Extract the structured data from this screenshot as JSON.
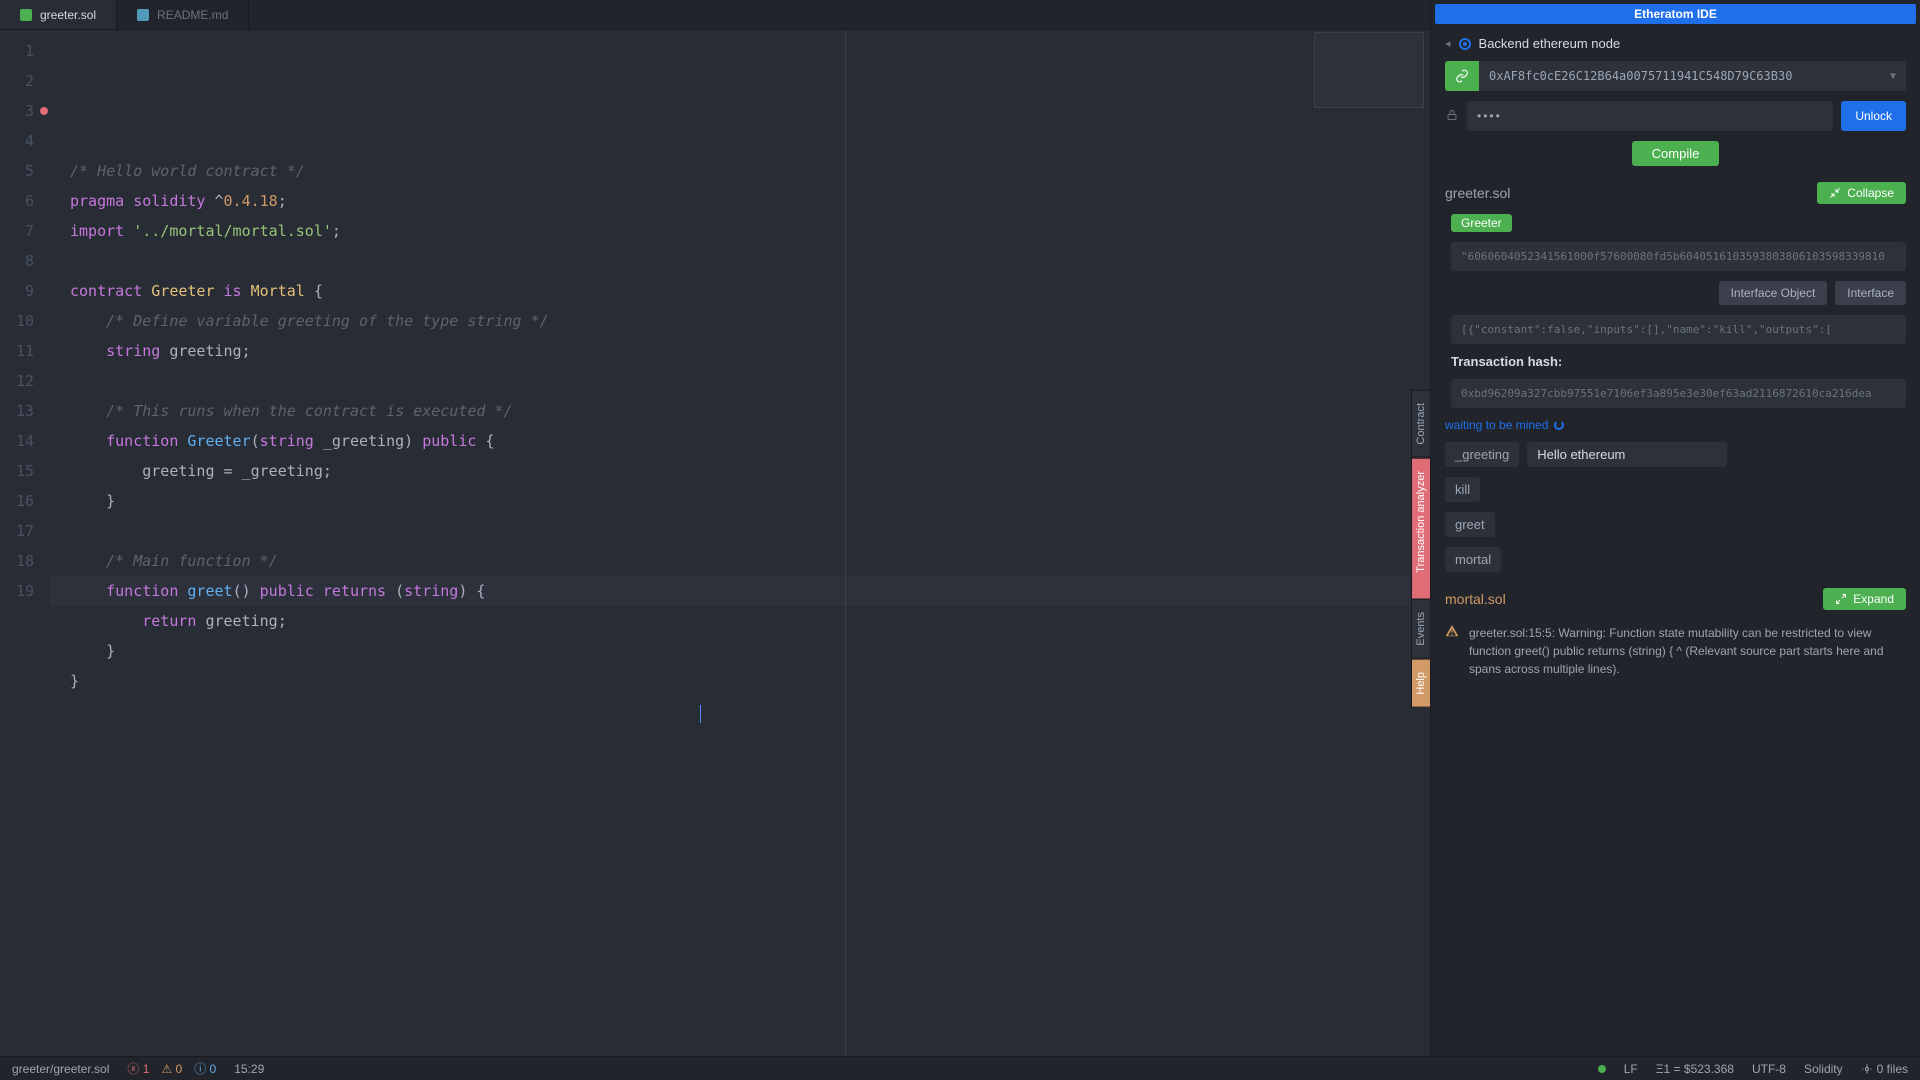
{
  "tabs": [
    {
      "label": "greeter.sol",
      "active": true,
      "icon": "sol"
    },
    {
      "label": "README.md",
      "active": false,
      "icon": "md"
    }
  ],
  "code": {
    "lines": [
      {
        "n": 1,
        "tokens": [
          [
            "cmt",
            "/* Hello world contract */"
          ]
        ]
      },
      {
        "n": 2,
        "tokens": [
          [
            "kw",
            "pragma"
          ],
          [
            "",
            " "
          ],
          [
            "kw",
            "solidity"
          ],
          [
            "",
            " ^"
          ],
          [
            "num",
            "0.4.18"
          ],
          [
            "",
            ";"
          ]
        ]
      },
      {
        "n": 3,
        "bp": true,
        "tokens": [
          [
            "kw",
            "import"
          ],
          [
            "",
            " "
          ],
          [
            "str",
            "'../mortal/mortal.sol'"
          ],
          [
            "",
            ";"
          ]
        ]
      },
      {
        "n": 4,
        "tokens": []
      },
      {
        "n": 5,
        "tokens": [
          [
            "kw",
            "contract"
          ],
          [
            "",
            " "
          ],
          [
            "cls",
            "Greeter"
          ],
          [
            "",
            " "
          ],
          [
            "kw",
            "is"
          ],
          [
            "",
            " "
          ],
          [
            "cls",
            "Mortal"
          ],
          [
            "",
            " {"
          ]
        ]
      },
      {
        "n": 6,
        "tokens": [
          [
            "",
            "    "
          ],
          [
            "cmt",
            "/* Define variable greeting of the type string */"
          ]
        ]
      },
      {
        "n": 7,
        "tokens": [
          [
            "",
            "    "
          ],
          [
            "typ",
            "string"
          ],
          [
            "",
            " greeting;"
          ]
        ]
      },
      {
        "n": 8,
        "tokens": []
      },
      {
        "n": 9,
        "tokens": [
          [
            "",
            "    "
          ],
          [
            "cmt",
            "/* This runs when the contract is executed */"
          ]
        ]
      },
      {
        "n": 10,
        "tokens": [
          [
            "",
            "    "
          ],
          [
            "kw",
            "function"
          ],
          [
            "",
            " "
          ],
          [
            "fn",
            "Greeter"
          ],
          [
            "",
            "("
          ],
          [
            "typ",
            "string"
          ],
          [
            "",
            " _greeting) "
          ],
          [
            "kw",
            "public"
          ],
          [
            "",
            " {"
          ]
        ]
      },
      {
        "n": 11,
        "tokens": [
          [
            "",
            "        greeting = _greeting;"
          ]
        ]
      },
      {
        "n": 12,
        "tokens": [
          [
            "",
            "    }"
          ]
        ]
      },
      {
        "n": 13,
        "tokens": []
      },
      {
        "n": 14,
        "tokens": [
          [
            "",
            "    "
          ],
          [
            "cmt",
            "/* Main function */"
          ]
        ]
      },
      {
        "n": 15,
        "hl": true,
        "tokens": [
          [
            "",
            "    "
          ],
          [
            "kw",
            "function"
          ],
          [
            "",
            " "
          ],
          [
            "fn",
            "greet"
          ],
          [
            "",
            "() "
          ],
          [
            "kw",
            "public"
          ],
          [
            "",
            " "
          ],
          [
            "kw",
            "returns"
          ],
          [
            "",
            " ("
          ],
          [
            "typ",
            "string"
          ],
          [
            "",
            ") {"
          ]
        ]
      },
      {
        "n": 16,
        "tokens": [
          [
            "",
            "        "
          ],
          [
            "kw",
            "return"
          ],
          [
            "",
            " greeting;"
          ]
        ]
      },
      {
        "n": 17,
        "tokens": [
          [
            "",
            "    }"
          ]
        ]
      },
      {
        "n": 18,
        "tokens": [
          [
            "",
            "}"
          ]
        ]
      },
      {
        "n": 19,
        "tokens": []
      }
    ]
  },
  "panel": {
    "title": "Etheratom IDE",
    "node_label": "Backend ethereum node",
    "address": "0xAF8fc0cE26C12B64a0075711941C548D79C63B30",
    "password_mask": "••••",
    "unlock": "Unlock",
    "compile": "Compile",
    "file1": "greeter.sol",
    "collapse": "Collapse",
    "expand": "Expand",
    "contract_name": "Greeter",
    "bytecode": "\"6060604052341561000f57600080fd5b6040516103593803806103598339810",
    "interface_object_btn": "Interface Object",
    "interface_btn": "Interface",
    "interface_json": "[{\"constant\":false,\"inputs\":[],\"name\":\"kill\",\"outputs\":[",
    "tx_hash_label": "Transaction hash:",
    "tx_hash": "0xbd96209a327cbb97551e7106ef3a895e3e30ef63ad2116872610ca216dea",
    "mining": "waiting to be mined",
    "fn_greeting_label": "_greeting",
    "fn_greeting_value": "Hello ethereum",
    "fn_kill": "kill",
    "fn_greet": "greet",
    "fn_mortal": "mortal",
    "file2": "mortal.sol",
    "warning": "greeter.sol:15:5: Warning: Function state mutability can be restricted to view function greet() public returns (string) { ^ (Relevant source part starts here and spans across multiple lines)."
  },
  "vtabs": {
    "contract": "Contract",
    "tx": "Transaction analyzer",
    "events": "Events",
    "help": "Help"
  },
  "status": {
    "path": "greeter/greeter.sol",
    "errors": "1",
    "warns": "0",
    "infos": "0",
    "cursor": "15:29",
    "lf": "LF",
    "eth": "Ξ1 = $523.368",
    "encoding": "UTF-8",
    "lang": "Solidity",
    "files": "0 files"
  }
}
